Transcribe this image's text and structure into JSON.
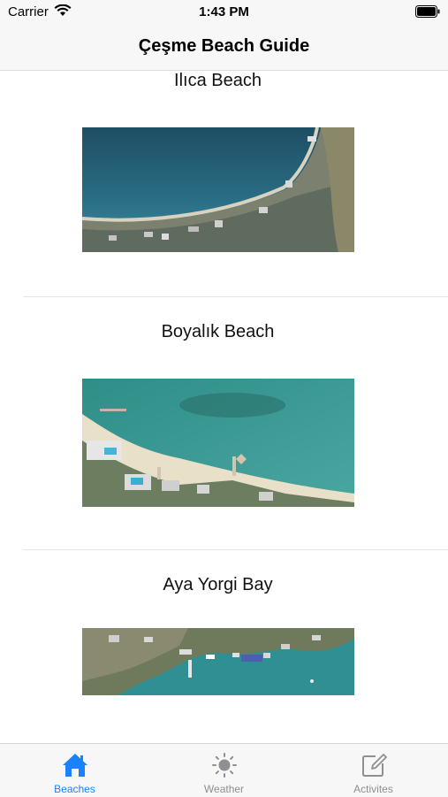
{
  "status_bar": {
    "carrier": "Carrier",
    "time": "1:43 PM"
  },
  "nav": {
    "title": "Çeşme Beach Guide"
  },
  "beaches": [
    {
      "name": "Ilıca Beach"
    },
    {
      "name": "Boyalık Beach"
    },
    {
      "name": "Aya Yorgi Bay"
    }
  ],
  "tabs": [
    {
      "label": "Beaches",
      "icon": "house-icon",
      "active": true
    },
    {
      "label": "Weather",
      "icon": "sun-icon",
      "active": false
    },
    {
      "label": "Activites",
      "icon": "compose-icon",
      "active": false
    }
  ],
  "colors": {
    "accent": "#1a82fb",
    "inactive": "#8e8e93",
    "bar_bg": "#f7f7f7"
  }
}
